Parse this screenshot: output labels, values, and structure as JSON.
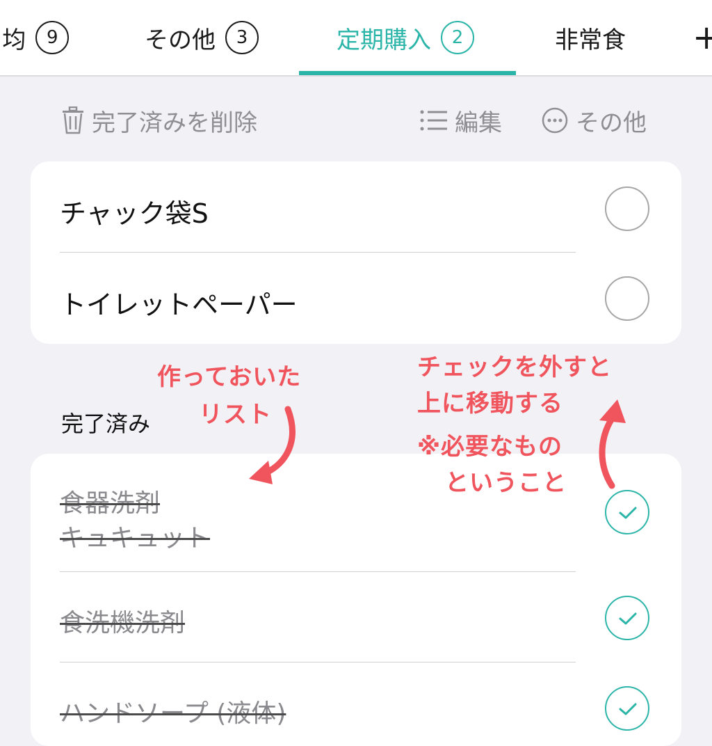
{
  "tabs": [
    {
      "label": "均",
      "count": "9",
      "partial_prefix": ")"
    },
    {
      "label": "その他",
      "count": "3"
    },
    {
      "label": "定期購入",
      "count": "2",
      "active": true
    },
    {
      "label": "非常食"
    }
  ],
  "add_tab": "+",
  "toolbar": {
    "delete_done_label": "完了済みを削除",
    "edit_label": "編集",
    "more_label": "その他"
  },
  "active_list": [
    {
      "label": "チャック袋S",
      "checked": false
    },
    {
      "label": "トイレットペーパー",
      "checked": false
    }
  ],
  "completed": {
    "title": "完了済み",
    "items": [
      {
        "line1": "食器洗剤",
        "line2": "キュキュット",
        "checked": true
      },
      {
        "line1": "食洗機洗剤",
        "checked": true
      },
      {
        "line1": "ハンドソープ (液体)",
        "checked": true
      }
    ]
  },
  "annotations": {
    "left_line1": "作っておいた",
    "left_line2": "リスト",
    "right_line1": "チェックを外すと",
    "right_line2": "上に移動する",
    "right_line3": "※必要なもの",
    "right_line4": "ということ"
  },
  "colors": {
    "accent": "#2bb5a8",
    "annotation": "#f0545c",
    "background": "#f2f1f6"
  }
}
